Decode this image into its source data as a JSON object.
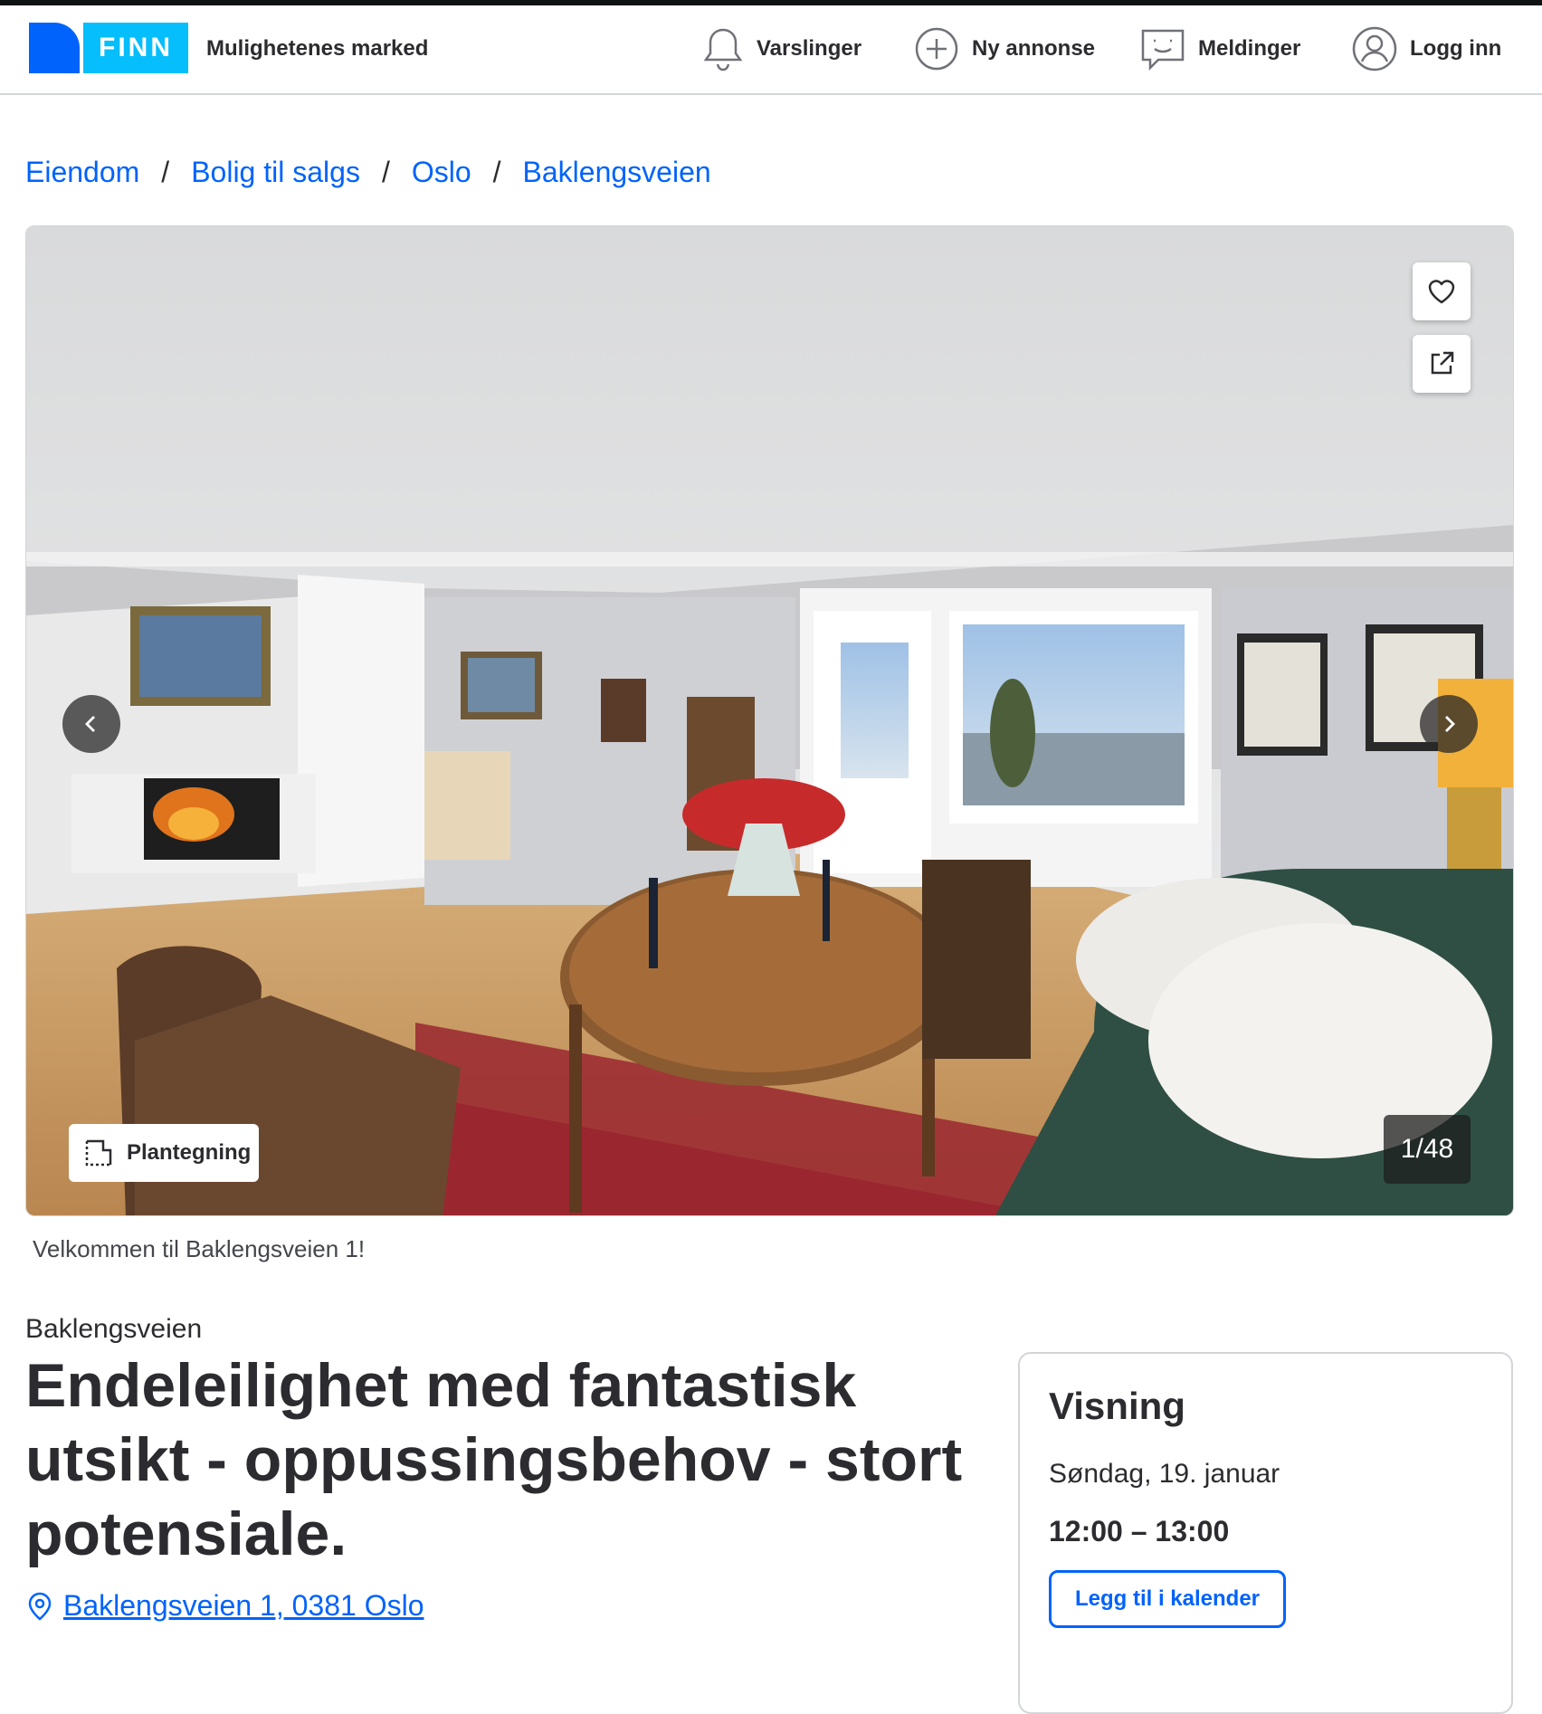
{
  "header": {
    "logo_text": "FINN",
    "tagline": "Mulighetenes marked",
    "nav": {
      "notifications": "Varslinger",
      "new_ad": "Ny annonse",
      "messages": "Meldinger",
      "login": "Logg inn"
    }
  },
  "breadcrumb": [
    "Eiendom",
    "Bolig til salgs",
    "Oslo",
    "Baklengsveien"
  ],
  "gallery": {
    "floorplan_label": "Plantegning",
    "counter": "1/48",
    "caption": "Velkommen til Baklengsveien 1!"
  },
  "listing": {
    "street": "Baklengsveien",
    "title": "Endeleilighet med fantastisk utsikt - oppussingsbehov - stort potensiale.",
    "address": "Baklengsveien 1, 0381 Oslo"
  },
  "viewing": {
    "heading": "Visning",
    "date": "Søndag, 19. januar",
    "time": "12:00 – 13:00",
    "calendar_button": "Legg til i kalender"
  },
  "colors": {
    "brand_blue": "#0063fb",
    "logo_light_blue": "#06befb"
  }
}
